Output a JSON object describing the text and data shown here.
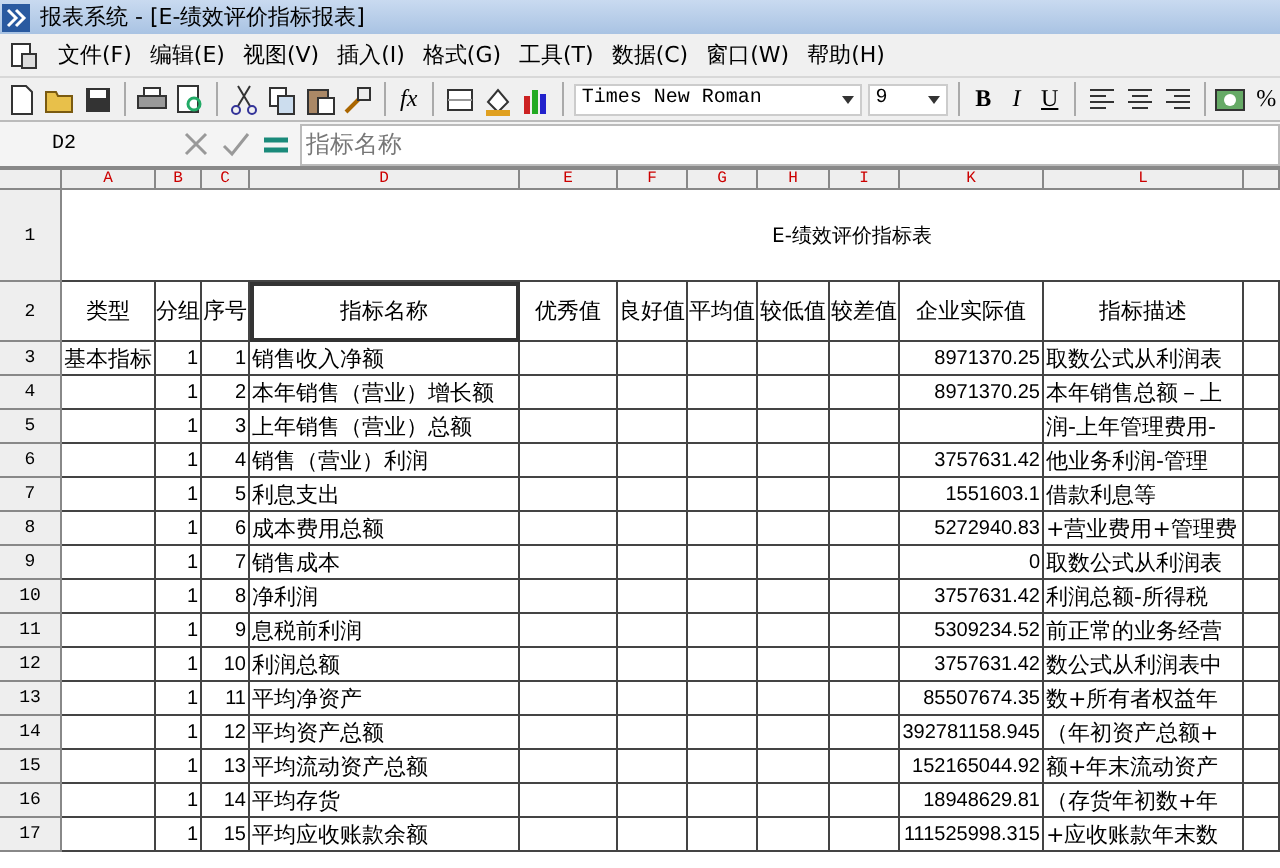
{
  "window": {
    "title": "报表系统 - [E-绩效评价指标报表]"
  },
  "menu": [
    "文件(F)",
    "编辑(E)",
    "视图(V)",
    "插入(I)",
    "格式(G)",
    "工具(T)",
    "数据(C)",
    "窗口(W)",
    "帮助(H)"
  ],
  "toolbar": {
    "fx": "fx",
    "font": "Times New Roman",
    "size": "9",
    "bold": "B",
    "italic": "I",
    "underline": "U",
    "percent": "%"
  },
  "formula_bar": {
    "cell": "D2",
    "value": "指标名称"
  },
  "sheet": {
    "columns": [
      "A",
      "B",
      "C",
      "D",
      "E",
      "F",
      "G",
      "H",
      "I",
      "K",
      "L"
    ],
    "title_row": {
      "row": "1",
      "text": "E-绩效评价指标表"
    },
    "header_row": {
      "row": "2",
      "cells": [
        {
          "text": "类型",
          "selected": false
        },
        {
          "text": "分组",
          "selected": false
        },
        {
          "text": "序号",
          "selected": false
        },
        {
          "text": "指标名称",
          "selected": true
        },
        {
          "text": "优秀值",
          "selected": false
        },
        {
          "text": "良好值",
          "selected": false
        },
        {
          "text": "平均值",
          "selected": false
        },
        {
          "text": "较低值",
          "selected": false
        },
        {
          "text": "较差值",
          "selected": false
        },
        {
          "text": "企业实际值",
          "selected": false
        },
        {
          "text": "指标描述",
          "selected": false
        }
      ]
    },
    "rows": [
      {
        "row": "3",
        "type": "基本指标",
        "group": "1",
        "no": "1",
        "name": "销售收入净额",
        "actual": "8971370.25",
        "description": "取数公式从利润表"
      },
      {
        "row": "4",
        "group": "1",
        "no": "2",
        "name": "本年销售（营业）增长额",
        "actual": "8971370.25",
        "description": "本年销售总额－上"
      },
      {
        "row": "5",
        "group": "1",
        "no": "3",
        "name": "上年销售（营业）总额",
        "description": "润-上年管理费用-"
      },
      {
        "row": "6",
        "group": "1",
        "no": "4",
        "name": "销售（营业）利润",
        "actual": "3757631.42",
        "description": "他业务利润-管理"
      },
      {
        "row": "7",
        "group": "1",
        "no": "5",
        "name": "利息支出",
        "actual": "1551603.1",
        "description": "借款利息等"
      },
      {
        "row": "8",
        "group": "1",
        "no": "6",
        "name": "成本费用总额",
        "actual": "5272940.83",
        "description": "+营业费用+管理费"
      },
      {
        "row": "9",
        "group": "1",
        "no": "7",
        "name": "销售成本",
        "actual": "0",
        "description": "取数公式从利润表"
      },
      {
        "row": "10",
        "group": "1",
        "no": "8",
        "name": "净利润",
        "actual": "3757631.42",
        "description": "利润总额-所得税"
      },
      {
        "row": "11",
        "group": "1",
        "no": "9",
        "name": "息税前利润",
        "actual": "5309234.52",
        "description": "前正常的业务经营"
      },
      {
        "row": "12",
        "group": "1",
        "no": "10",
        "name": "利润总额",
        "actual": "3757631.42",
        "description": "数公式从利润表中"
      },
      {
        "row": "13",
        "group": "1",
        "no": "11",
        "name": "平均净资产",
        "actual": "85507674.35",
        "description": "数+所有者权益年"
      },
      {
        "row": "14",
        "group": "1",
        "no": "12",
        "name": "平均资产总额",
        "actual": "392781158.945",
        "description": "（年初资产总额+"
      },
      {
        "row": "15",
        "group": "1",
        "no": "13",
        "name": "平均流动资产总额",
        "actual": "152165044.92",
        "description": "额+年末流动资产"
      },
      {
        "row": "16",
        "group": "1",
        "no": "14",
        "name": "平均存货",
        "actual": "18948629.81",
        "description": "（存货年初数+年"
      },
      {
        "row": "17",
        "group": "1",
        "no": "15",
        "name": "平均应收账款余额",
        "actual": "111525998.315",
        "description": "+应收账款年末数"
      }
    ]
  }
}
